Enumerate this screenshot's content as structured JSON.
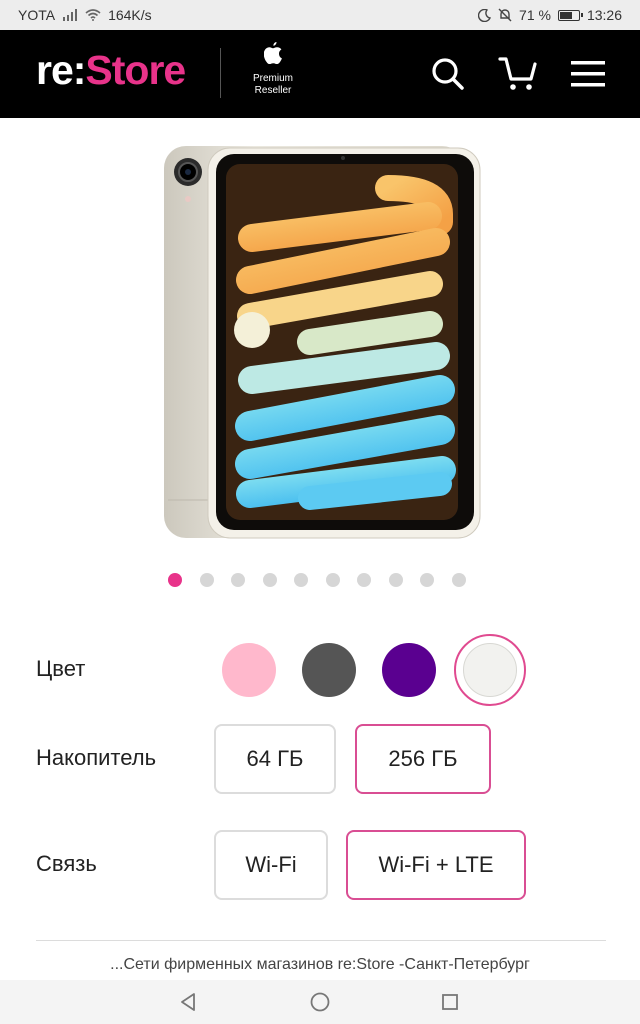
{
  "status_bar": {
    "carrier": "YOTA",
    "speed": "164K/s",
    "battery": "71 %",
    "battery_level": 0.71,
    "time": "13:26"
  },
  "header": {
    "logo_prefix": "re:",
    "logo_suffix": "Store",
    "badge_line1": "Premium",
    "badge_line2": "Reseller"
  },
  "gallery": {
    "total_images": 10,
    "active_index": 0
  },
  "options": {
    "color": {
      "label": "Цвет",
      "swatches": [
        "#ffb8cc",
        "#555555",
        "#5a0090",
        "#f2f2ef"
      ],
      "selected_index": 3
    },
    "storage": {
      "label": "Накопитель",
      "values": [
        "64 ГБ",
        "256 ГБ"
      ],
      "selected_index": 1
    },
    "connectivity": {
      "label": "Связь",
      "values": [
        "Wi-Fi",
        "Wi-Fi + LTE"
      ],
      "selected_index": 1
    }
  },
  "store_text": "...Сети фирменных магазинов re:Store -Санкт-Петербург",
  "colors": {
    "accent": "#e8338a",
    "header_bg": "#000000"
  }
}
